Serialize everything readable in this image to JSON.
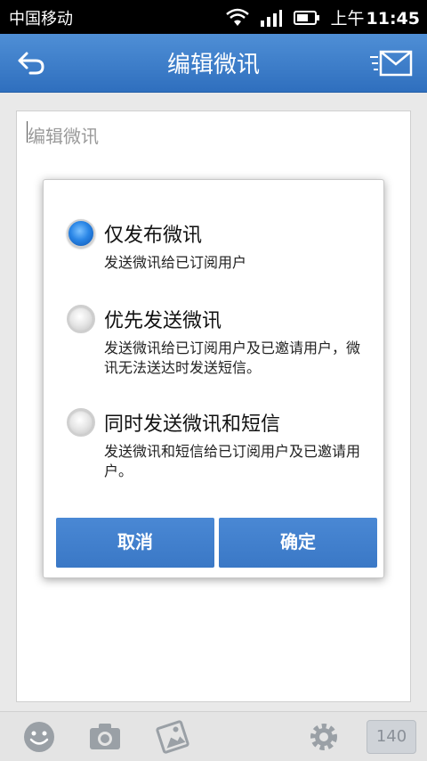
{
  "status_bar": {
    "carrier": "中国移动",
    "ampm": "上午",
    "time": "11:45"
  },
  "header": {
    "title": "编辑微讯"
  },
  "editor": {
    "placeholder": "编辑微讯"
  },
  "dialog": {
    "options": [
      {
        "title": "仅发布微讯",
        "desc": "发送微讯给已订阅用户",
        "selected": true
      },
      {
        "title": "优先发送微讯",
        "desc": "发送微讯给已订阅用户及已邀请用户，微讯无法送达时发送短信。",
        "selected": false
      },
      {
        "title": "同时发送微讯和短信",
        "desc": "发送微讯和短信给已订阅用户及已邀请用户。",
        "selected": false
      }
    ],
    "cancel_label": "取消",
    "ok_label": "确定"
  },
  "toolbar": {
    "icons": [
      "smiley-icon",
      "camera-icon",
      "picture-icon",
      "gear-icon"
    ],
    "char_count": "140"
  },
  "colors": {
    "accent": "#3a78c6",
    "header": "#2f6fbe"
  }
}
